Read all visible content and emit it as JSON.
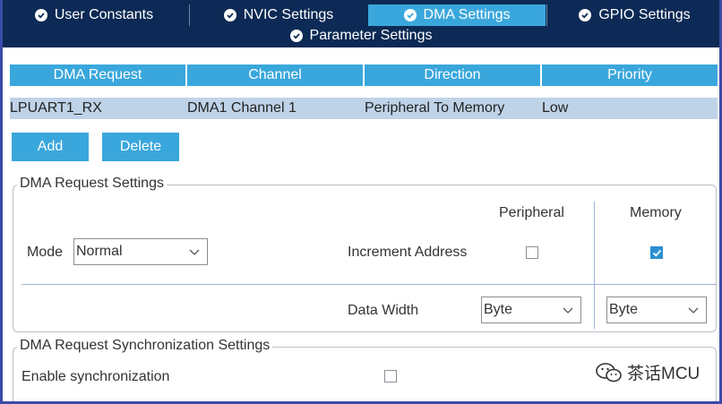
{
  "tabs": [
    {
      "label": "User Constants",
      "active": false
    },
    {
      "label": "NVIC Settings",
      "active": false
    },
    {
      "label": "DMA Settings",
      "active": true
    },
    {
      "label": "GPIO Settings",
      "active": false
    }
  ],
  "param_tab": {
    "label": "Parameter Settings"
  },
  "table": {
    "headers": [
      "DMA Request",
      "Channel",
      "Direction",
      "Priority"
    ],
    "rows": [
      [
        "LPUART1_RX",
        "DMA1 Channel 1",
        "Peripheral To Memory",
        "Low"
      ]
    ]
  },
  "buttons": {
    "add": "Add",
    "delete": "Delete"
  },
  "dma_request_settings": {
    "title": "DMA Request Settings",
    "peripheral_header": "Peripheral",
    "memory_header": "Memory",
    "mode_label": "Mode",
    "mode_value": "Normal",
    "increment_address_label": "Increment Address",
    "peripheral_increment": false,
    "memory_increment": true,
    "data_width_label": "Data Width",
    "peripheral_data_width": "Byte",
    "memory_data_width": "Byte"
  },
  "sync_settings": {
    "title": "DMA Request Synchronization Settings",
    "enable_label": "Enable synchronization",
    "enabled": false
  },
  "watermark": {
    "text": "茶话MCU"
  },
  "colors": {
    "tab_bg": "#0c2a55",
    "tab_active": "#3aa7dc",
    "row_selected": "#bfd3e8",
    "checkbox_checked": "#2b8fd0"
  }
}
